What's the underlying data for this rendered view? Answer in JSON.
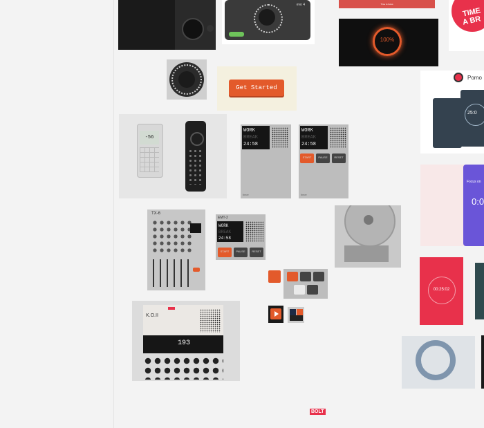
{
  "cards": {
    "get_started": {
      "label": "Get Started"
    },
    "timer_device_a": {
      "lcd": [
        "WORK",
        "BREAK",
        "24:58"
      ],
      "brand": "timer"
    },
    "timer_device_b": {
      "lcd": [
        "WORK",
        "BREAK",
        "24:58"
      ],
      "brand": "timer",
      "buttons": [
        "START",
        "PAUSE",
        "RESET"
      ]
    },
    "timer_small": {
      "title": "EMT-2",
      "lcd": [
        "WORK",
        "BREAK",
        "24:58"
      ],
      "buttons": [
        "START",
        "PAUSE",
        "RESET"
      ]
    },
    "mixer": {
      "title": "TX-6"
    },
    "ko2": {
      "title": "K.O.II",
      "display": "193"
    },
    "ring_timer": {
      "value": "100%"
    },
    "red_timer": {
      "value": "00:25:02"
    },
    "pomodoro": {
      "title": "Pomo",
      "time": "25:0"
    },
    "focus": {
      "text": "Focus on",
      "time": "0:0"
    },
    "badge": {
      "line1": "TIME",
      "line2": "A BR"
    },
    "audio": {
      "brand": "evo 4"
    },
    "red_strip": {
      "text": "Time to focus"
    },
    "phone_a": {
      "value": "-56"
    }
  },
  "footer": {
    "logo": "BOLT"
  },
  "colors": {
    "accent": "#e35a2b",
    "red": "#e8314b",
    "dark": "#1e1e1e",
    "purple": "#6a55d8"
  }
}
